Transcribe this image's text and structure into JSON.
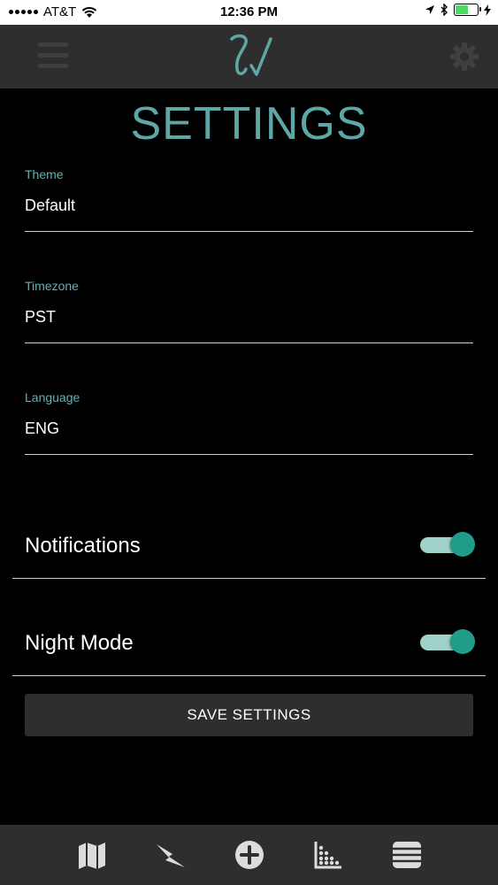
{
  "status_bar": {
    "carrier": "AT&T",
    "time": "12:36 PM"
  },
  "header": {
    "menu_icon": "hamburger-icon",
    "logo_icon": "script-logo-icon",
    "settings_icon": "gear-icon"
  },
  "page": {
    "title": "SETTINGS"
  },
  "fields": [
    {
      "label": "Theme",
      "value": "Default"
    },
    {
      "label": "Timezone",
      "value": "PST"
    },
    {
      "label": "Language",
      "value": "ENG"
    }
  ],
  "toggles": [
    {
      "label": "Notifications",
      "on": true
    },
    {
      "label": "Night Mode",
      "on": true
    }
  ],
  "actions": {
    "save_label": "SAVE SETTINGS"
  },
  "bottom_nav": [
    "map-icon",
    "lightning-icon",
    "add-circle-icon",
    "chart-icon",
    "list-icon"
  ],
  "colors": {
    "accent": "#5fa6a6",
    "toggle_on": "#1f9c8a",
    "bar": "#2e2e2e",
    "background": "#000000"
  }
}
